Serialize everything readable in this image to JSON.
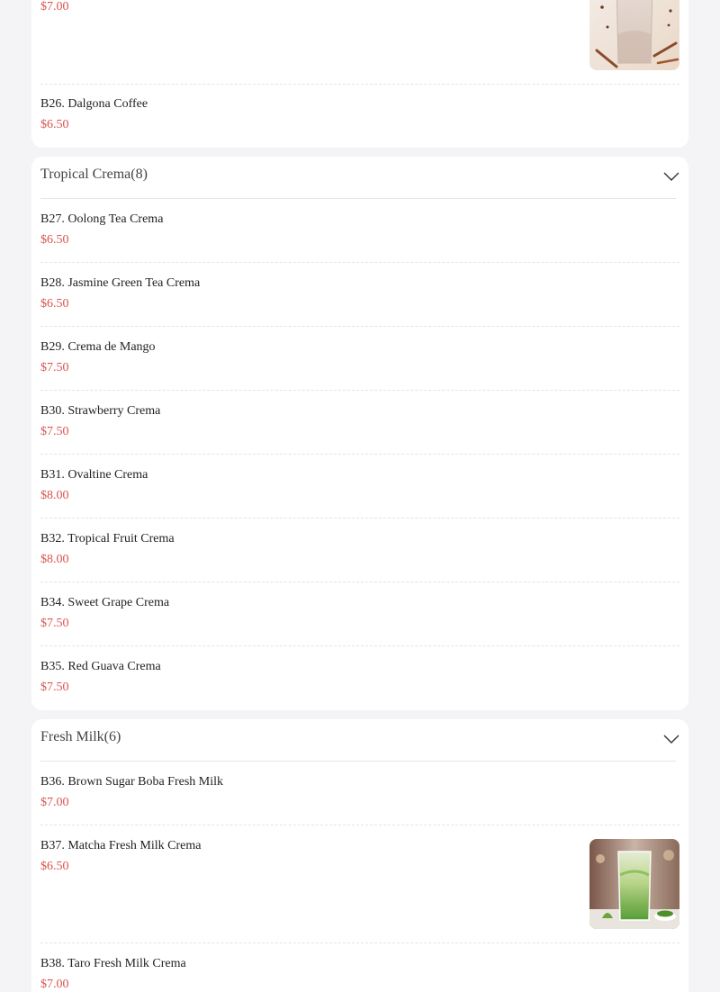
{
  "top_card": {
    "items": [
      {
        "name": "",
        "price": "$7.00",
        "image_icon": "iced-latte-photo"
      },
      {
        "name": "B26. Dalgona Coffee",
        "price": "$6.50"
      }
    ]
  },
  "tropical_crema": {
    "title": "Tropical Crema(8)",
    "toggle_icon": "chevron-down-icon",
    "items": [
      {
        "name": "B27. Oolong Tea Crema",
        "price": "$6.50"
      },
      {
        "name": "B28. Jasmine Green Tea Crema",
        "price": "$6.50"
      },
      {
        "name": "B29. Crema de Mango",
        "price": "$7.50"
      },
      {
        "name": "B30. Strawberry Crema",
        "price": "$7.50"
      },
      {
        "name": "B31. Ovaltine Crema",
        "price": "$8.00"
      },
      {
        "name": "B32. Tropical Fruit Crema",
        "price": "$8.00"
      },
      {
        "name": "B34. Sweet Grape Crema",
        "price": "$7.50"
      },
      {
        "name": "B35. Red Guava Crema",
        "price": "$7.50"
      }
    ]
  },
  "fresh_milk": {
    "title": "Fresh Milk(6)",
    "toggle_icon": "chevron-down-icon",
    "items": [
      {
        "name": "B36. Brown Sugar Boba Fresh Milk",
        "price": "$7.00"
      },
      {
        "name": "B37. Matcha Fresh Milk Crema",
        "price": "$6.50",
        "image_icon": "matcha-drink-photo"
      },
      {
        "name": "B38. Taro Fresh Milk Crema",
        "price": "$7.00"
      }
    ]
  },
  "colors": {
    "background": "#f4f4f6",
    "card": "#ffffff",
    "price": "#d9534f",
    "text": "#222222"
  }
}
